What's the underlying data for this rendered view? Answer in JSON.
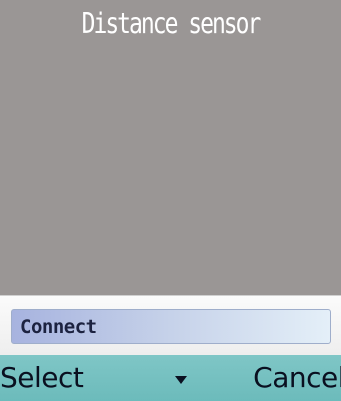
{
  "app": {
    "title": "Distance sensor"
  },
  "menu": {
    "items": [
      {
        "label": "Connect",
        "selected": true
      }
    ]
  },
  "softkeys": {
    "left": "Select",
    "center_icon": "down-arrow-icon",
    "right": "Cancel"
  },
  "colors": {
    "background": "#9a9695",
    "title_text": "#ffffff",
    "softkey_bar": "#6cbbbb",
    "menu_highlight_start": "#a7b3df",
    "menu_highlight_end": "#e4eff8"
  }
}
